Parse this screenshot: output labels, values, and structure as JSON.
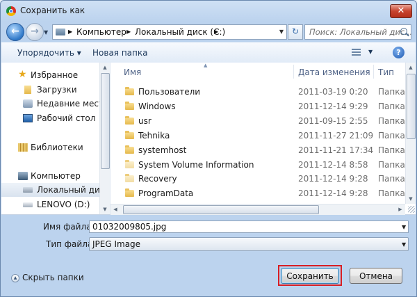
{
  "window": {
    "title": "Сохранить как",
    "close_label": "✕"
  },
  "nav": {
    "breadcrumbs": [
      "Компьютер",
      "Локальный диск (C:)"
    ],
    "search_placeholder": "Поиск: Локальный дис..."
  },
  "toolbar": {
    "organize": "Упорядочить",
    "new_folder": "Новая папка",
    "help": "?"
  },
  "sidebar": {
    "items": [
      {
        "label": "Избранное",
        "icon": "star-icon"
      },
      {
        "label": "Загрузки",
        "icon": "downloads-icon"
      },
      {
        "label": "Недавние места",
        "icon": "recent-places-icon"
      },
      {
        "label": "Рабочий стол",
        "icon": "desktop-icon"
      },
      {
        "label": "Библиотеки",
        "icon": "libraries-icon"
      },
      {
        "label": "Компьютер",
        "icon": "computer-icon"
      },
      {
        "label": "Локальный диск",
        "icon": "local-disk-icon"
      },
      {
        "label": "LENOVO (D:)",
        "icon": "drive-icon"
      }
    ]
  },
  "files": {
    "columns": [
      "Имя",
      "Дата изменения",
      "Тип"
    ],
    "rows": [
      {
        "name": "Пользователи",
        "date": "2011-03-19 0:20",
        "type": "Папка"
      },
      {
        "name": "Windows",
        "date": "2011-12-14 9:29",
        "type": "Папка"
      },
      {
        "name": "usr",
        "date": "2011-09-15 2:55",
        "type": "Папка"
      },
      {
        "name": "Tehnika",
        "date": "2011-11-27 21:09",
        "type": "Папка"
      },
      {
        "name": "systemhost",
        "date": "2011-11-21 17:34",
        "type": "Папка"
      },
      {
        "name": "System Volume Information",
        "date": "2011-12-14 8:58",
        "type": "Папка"
      },
      {
        "name": "Recovery",
        "date": "2011-12-14 9:28",
        "type": "Папка"
      },
      {
        "name": "ProgramData",
        "date": "2011-12-14 9:28",
        "type": "Папка"
      }
    ]
  },
  "form": {
    "filename_label": "Имя файла:",
    "filename_value": "01032009805.jpg",
    "filetype_label": "Тип файла:",
    "filetype_value": "JPEG Image"
  },
  "footer": {
    "hide_folders": "Скрыть папки",
    "save": "Сохранить",
    "cancel": "Отмена"
  },
  "colors": {
    "highlight": "#d81e24",
    "accent": "#2f78c8"
  }
}
